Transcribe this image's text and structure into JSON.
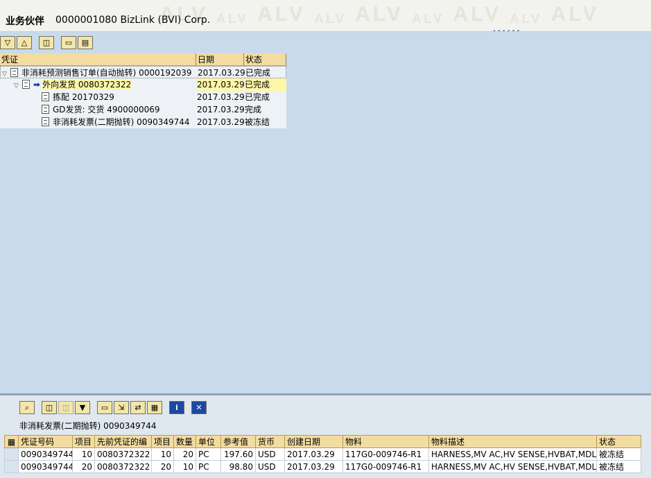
{
  "header": {
    "label": "业务伙伴",
    "value": "0000001080 BizLink (BVI) Corp.",
    "watermark": "ALV",
    "dots": "••••••"
  },
  "toolbar_top": {
    "icons": [
      "expand-all-icon",
      "collapse-all-icon",
      "find-icon",
      "print-icon",
      "print-preview-icon"
    ]
  },
  "tree": {
    "columns": [
      "凭证",
      "日期",
      "状态"
    ],
    "rows": [
      {
        "label": "非消耗预测销售订单(自动抛转) 0000192039",
        "date": "2017.03.29",
        "status": "已完成"
      },
      {
        "label": "外向发货 0080372322",
        "date": "2017.03.29",
        "status": "已完成"
      },
      {
        "label": "拣配 20170329",
        "date": "2017.03.29",
        "status": "已完成"
      },
      {
        "label": "GD发货: 交货 4900000069",
        "date": "2017.03.29",
        "status": "完成"
      },
      {
        "label": "非消耗发票(二期抛转) 0090349744",
        "date": "2017.03.29",
        "status": "被冻结"
      }
    ]
  },
  "bottom": {
    "title": "非消耗发票(二期抛转) 0090349744",
    "toolbar_icons": [
      "details-icon",
      "find-icon",
      "find-next-icon",
      "filter-icon",
      "print-icon",
      "export-icon",
      "spreadsheet-icon",
      "layout-icon",
      "info-icon",
      "close-icon"
    ],
    "info_label": "i",
    "close_label": "✕",
    "columns": [
      "凭证号码",
      "项目",
      "先前凭证的编",
      "项目",
      "数量",
      "单位",
      "参考值",
      "货币",
      "创建日期",
      "物料",
      "物料描述",
      "状态"
    ],
    "rows": [
      [
        "0090349744",
        "10",
        "0080372322",
        "10",
        "20",
        "PC",
        "197.60",
        "USD",
        "2017.03.29",
        "117G0-009746-R1",
        "HARNESS,MV AC,HV SENSE,HVBAT,MDLS,",
        "被冻结"
      ],
      [
        "0090349744",
        "20",
        "0080372322",
        "20",
        "10",
        "PC",
        "98.80",
        "USD",
        "2017.03.29",
        "117G0-009746-R1",
        "HARNESS,MV AC,HV SENSE,HVBAT,MDLS,",
        "被冻结"
      ]
    ]
  },
  "colors": {
    "tree_bg": "#c9daea",
    "header_cell": "#f3dca0",
    "selected_row": "#fff7a8",
    "button": "#f3e6a8"
  }
}
